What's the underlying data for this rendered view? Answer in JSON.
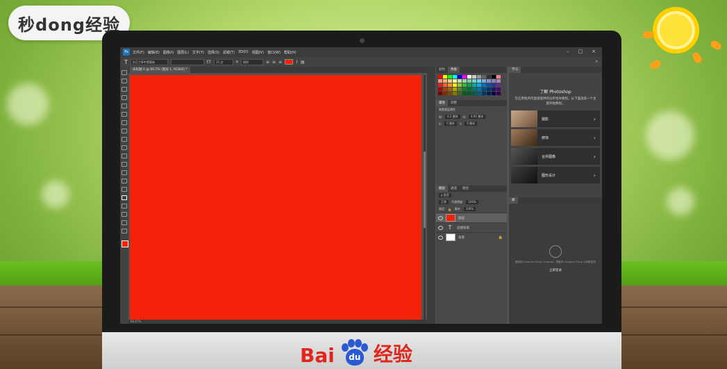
{
  "watermark": {
    "text": "秒dong经验"
  },
  "brand": {
    "logo_text": "Bai",
    "paw_text": "du",
    "suffix": "经验"
  },
  "menu": [
    "文件(F)",
    "编辑(E)",
    "图像(I)",
    "图层(L)",
    "文字(Y)",
    "选择(S)",
    "滤镜(T)",
    "3D(D)",
    "视图(V)",
    "窗口(W)",
    "帮助(H)"
  ],
  "options": {
    "font_family": "方正兰亭中黑简体",
    "font_size": "15 点",
    "aa_mode": "锐利",
    "text_color": "#ff2000"
  },
  "document": {
    "tab": "未标题-1 @ 66.7% (图层 1, RGB/8) *",
    "canvas_color": "#f5220a",
    "status": "66.67%"
  },
  "swatches_panel": {
    "tab1": "颜色",
    "tab2": "色板"
  },
  "properties_panel": {
    "tab1": "属性",
    "tab2": "调整",
    "header": "像素图层属性",
    "w_label": "W:",
    "w": "6.2 厘米",
    "h_label": "H:",
    "h": "4.91 厘米",
    "x_label": "X:",
    "x": "0 厘米",
    "y_label": "Y:",
    "y": "0 厘米"
  },
  "layers_panel": {
    "tabs": [
      "图层",
      "通道",
      "路径"
    ],
    "kind": "ρ 类型",
    "blend": "正常",
    "opacity_label": "不透明度:",
    "opacity": "100%",
    "lock_label": "锁定:",
    "fill_label": "填充:",
    "fill": "100%",
    "layers": [
      {
        "name": "图层",
        "thumb": "#f5220a",
        "selected": true
      },
      {
        "name": "品搜技能",
        "thumb": "text",
        "selected": false
      },
      {
        "name": "背景",
        "thumb": "#ffffff",
        "selected": false
      }
    ]
  },
  "learn_panel": {
    "tab": "学习",
    "title": "了解 Photoshop",
    "desc": "在应用程序内直接提供的分步指导教程。从下面选取一个主题开始教程。",
    "items": [
      "摄影",
      "修饰",
      "合并图像",
      "图形设计"
    ]
  },
  "libraries_panel": {
    "tab": "库",
    "text": "要使用 Creative Cloud Libraries，请登录 Creative Cloud 以获取更多",
    "link": "立即登录"
  }
}
